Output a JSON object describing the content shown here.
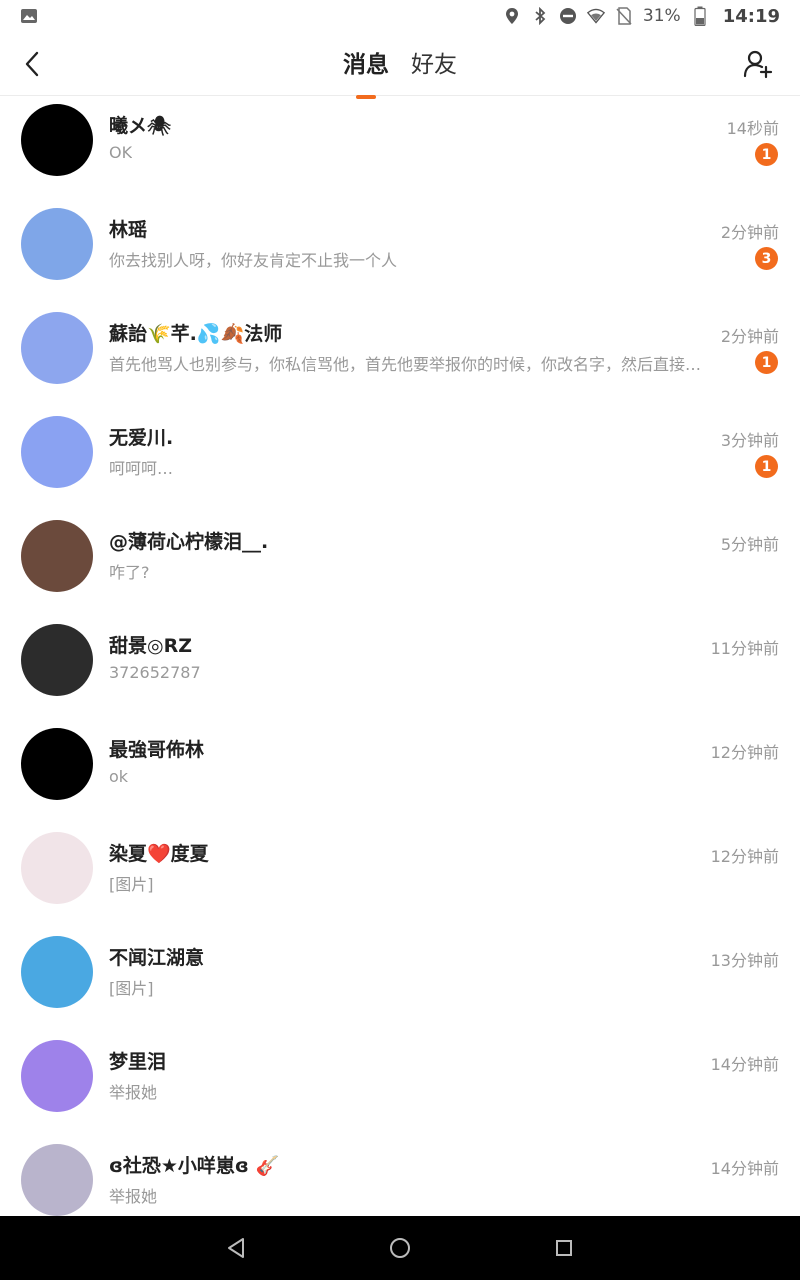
{
  "statusbar": {
    "battery": "31%",
    "time": "14:19",
    "icons": [
      "image-icon",
      "location-icon",
      "bluetooth-icon",
      "do-not-disturb-icon",
      "wifi-icon",
      "no-sim-icon",
      "battery-icon"
    ]
  },
  "header": {
    "back_icon": "chevron-left-icon",
    "tabs": [
      {
        "label": "消息",
        "active": true
      },
      {
        "label": "好友",
        "active": false
      }
    ],
    "add_icon": "add-friend-icon",
    "accent": "#f26b1d"
  },
  "conversations": [
    {
      "name": "曦メ🕷",
      "preview": "OK",
      "time": "14秒前",
      "badge": "1",
      "avatar_color": "#000000"
    },
    {
      "name": "林瑶",
      "preview": "你去找别人呀，你好友肯定不止我一个人",
      "time": "2分钟前",
      "badge": "3",
      "avatar_color": "#7fa6e8"
    },
    {
      "name": "蘇詒🌾芊.💦🍂法师",
      "preview": "首先他骂人也别参与，你私信骂他，首先他要举报你的时候，你改名字，然后直接改…",
      "time": "2分钟前",
      "badge": "1",
      "avatar_color": "#8da6ee"
    },
    {
      "name": "无爱川.",
      "preview": "呵呵呵…",
      "time": "3分钟前",
      "badge": "1",
      "avatar_color": "#8aa2f2"
    },
    {
      "name": "@薄荷心柠檬泪__.",
      "preview": "咋了?",
      "time": "5分钟前",
      "badge": "",
      "avatar_color": "#6b4a3c"
    },
    {
      "name": "甜景◎RZ",
      "preview": "372652787",
      "time": "11分钟前",
      "badge": "",
      "avatar_color": "#2c2c2c"
    },
    {
      "name": "最強哥佈林",
      "preview": "ok",
      "time": "12分钟前",
      "badge": "",
      "avatar_color": "#000000"
    },
    {
      "name": "染夏❤️度夏",
      "preview": "[图片]",
      "time": "12分钟前",
      "badge": "",
      "avatar_color": "#f1e4e8"
    },
    {
      "name": "不闻江湖意",
      "preview": "[图片]",
      "time": "13分钟前",
      "badge": "",
      "avatar_color": "#4aa8e2"
    },
    {
      "name": "梦里泪",
      "preview": "举报她",
      "time": "14分钟前",
      "badge": "",
      "avatar_color": "#9e82ea"
    },
    {
      "name": "ɞ社恐★小咩崽ɞ 🎸",
      "preview": "举报她",
      "time": "14分钟前",
      "badge": "",
      "avatar_color": "#b9b4cc"
    }
  ],
  "navbar": {
    "icons": [
      "back-triangle-icon",
      "home-circle-icon",
      "recents-square-icon"
    ]
  }
}
